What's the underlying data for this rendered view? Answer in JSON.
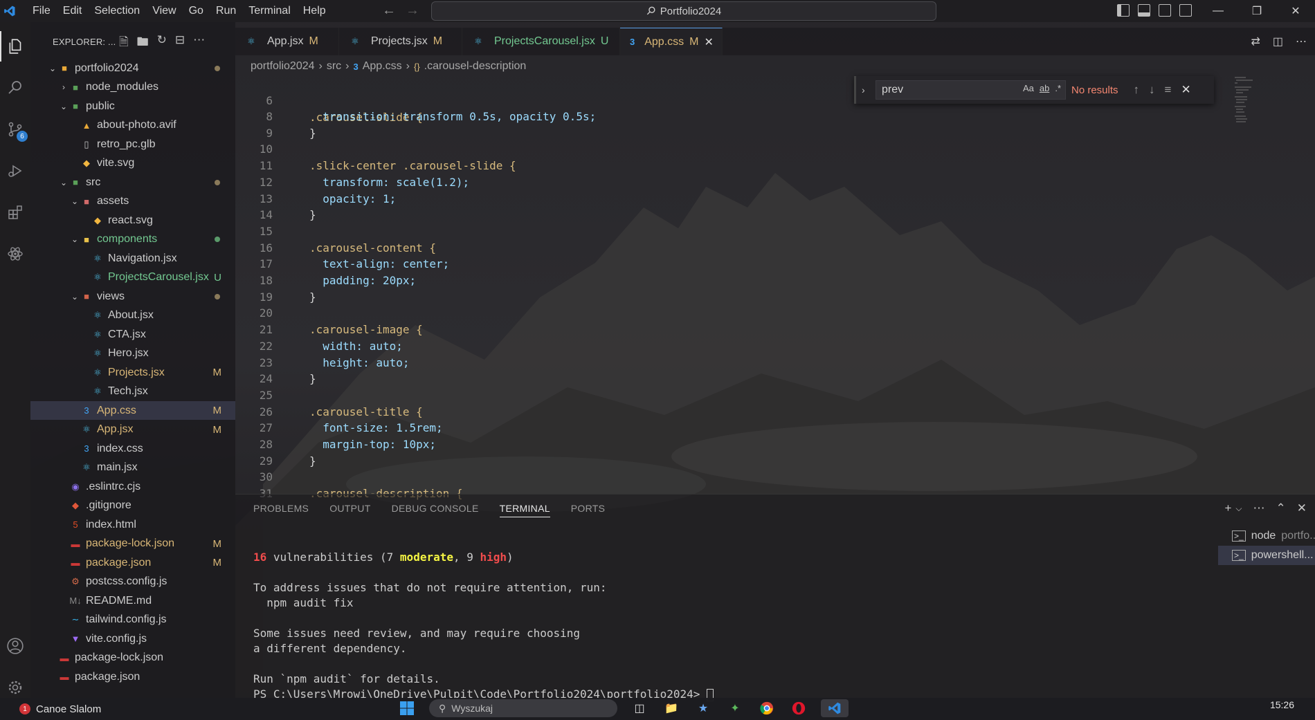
{
  "titlebar": {
    "menu": [
      "File",
      "Edit",
      "Selection",
      "View",
      "Go",
      "Run",
      "Terminal",
      "Help"
    ],
    "search_text": "Portfolio2024"
  },
  "activitybar": {
    "scm_badge": "6"
  },
  "sidebar": {
    "title": "EXPLORER: ...",
    "rows": [
      {
        "label": "portfolio2024",
        "status": "dot"
      },
      {
        "label": "node_modules"
      },
      {
        "label": "public"
      },
      {
        "label": "about-photo.avif"
      },
      {
        "label": "retro_pc.glb"
      },
      {
        "label": "vite.svg"
      },
      {
        "label": "src",
        "status": "dot"
      },
      {
        "label": "assets"
      },
      {
        "label": "react.svg"
      },
      {
        "label": "components",
        "status": "dot-green"
      },
      {
        "label": "Navigation.jsx"
      },
      {
        "label": "ProjectsCarousel.jsx",
        "status": "U"
      },
      {
        "label": "views",
        "status": "dot"
      },
      {
        "label": "About.jsx"
      },
      {
        "label": "CTA.jsx"
      },
      {
        "label": "Hero.jsx"
      },
      {
        "label": "Projects.jsx",
        "status": "M"
      },
      {
        "label": "Tech.jsx"
      },
      {
        "label": "App.css",
        "status": "M"
      },
      {
        "label": "App.jsx",
        "status": "M"
      },
      {
        "label": "index.css"
      },
      {
        "label": "main.jsx"
      },
      {
        "label": ".eslintrc.cjs"
      },
      {
        "label": ".gitignore"
      },
      {
        "label": "index.html"
      },
      {
        "label": "package-lock.json",
        "status": "M"
      },
      {
        "label": "package.json",
        "status": "M"
      },
      {
        "label": "postcss.config.js"
      },
      {
        "label": "README.md"
      },
      {
        "label": "tailwind.config.js"
      },
      {
        "label": "vite.config.js"
      },
      {
        "label": "package-lock.json"
      },
      {
        "label": "package.json"
      }
    ]
  },
  "tabs": [
    {
      "label": "App.jsx",
      "status": "M"
    },
    {
      "label": "Projects.jsx",
      "status": "M"
    },
    {
      "label": "ProjectsCarousel.jsx",
      "status": "U"
    },
    {
      "label": "App.css",
      "status": "M"
    }
  ],
  "breadcrumb": [
    "portfolio2024",
    "src",
    "App.css",
    ".carousel-description"
  ],
  "editor": {
    "sticky_line": {
      "num": "6",
      "text": ".carousel-slide {"
    },
    "lines": [
      {
        "num": "8",
        "text": "  transition: transform 0.5s, opacity 0.5s;"
      },
      {
        "num": "9",
        "text": "}"
      },
      {
        "num": "10",
        "text": ""
      },
      {
        "num": "11",
        "text": ".slick-center .carousel-slide {"
      },
      {
        "num": "12",
        "text": "  transform: scale(1.2);"
      },
      {
        "num": "13",
        "text": "  opacity: 1;"
      },
      {
        "num": "14",
        "text": "}"
      },
      {
        "num": "15",
        "text": ""
      },
      {
        "num": "16",
        "text": ".carousel-content {"
      },
      {
        "num": "17",
        "text": "  text-align: center;"
      },
      {
        "num": "18",
        "text": "  padding: 20px;"
      },
      {
        "num": "19",
        "text": "}"
      },
      {
        "num": "20",
        "text": ""
      },
      {
        "num": "21",
        "text": ".carousel-image {"
      },
      {
        "num": "22",
        "text": "  width: auto;"
      },
      {
        "num": "23",
        "text": "  height: auto;"
      },
      {
        "num": "24",
        "text": "}"
      },
      {
        "num": "25",
        "text": ""
      },
      {
        "num": "26",
        "text": ".carousel-title {"
      },
      {
        "num": "27",
        "text": "  font-size: 1.5rem;"
      },
      {
        "num": "28",
        "text": "  margin-top: 10px;"
      },
      {
        "num": "29",
        "text": "}"
      },
      {
        "num": "30",
        "text": ""
      },
      {
        "num": "31",
        "text": ".carousel-description {"
      }
    ]
  },
  "find": {
    "query": "prev",
    "opt_case": "Aa",
    "opt_word": "ab",
    "opt_regex": ".*",
    "result": "No results"
  },
  "panel": {
    "tabs": [
      "PROBLEMS",
      "OUTPUT",
      "DEBUG CONSOLE",
      "TERMINAL",
      "PORTS"
    ],
    "active_tab": "TERMINAL",
    "terminal": {
      "vuln_count": "16",
      "vuln_text": " vulnerabilities (7 ",
      "moderate": "moderate",
      "mid": ", 9 ",
      "high": "high",
      "end": ")",
      "line2": "To address issues that do not require attention, run:",
      "line3": "  npm audit fix",
      "line4": "Some issues need review, and may require choosing",
      "line5": "a different dependency.",
      "line6": "Run `npm audit` for details.",
      "prompt": "PS C:\\Users\\Mrowi\\OneDrive\\Pulpit\\Code\\Portfolio2024\\portfolio2024> "
    },
    "terminals": [
      {
        "name": "node",
        "sub": "portfo..."
      },
      {
        "name": "powershell...",
        "sub": ""
      }
    ]
  },
  "taskbar": {
    "app_badge": "1",
    "app_label": "Canoe Slalom",
    "search_placeholder": "Wyszukaj",
    "time": "15:26"
  },
  "colors": {
    "accent": "#2f7fcf",
    "modified": "#d9b777",
    "untracked": "#73c991",
    "no_results": "#f48771"
  }
}
